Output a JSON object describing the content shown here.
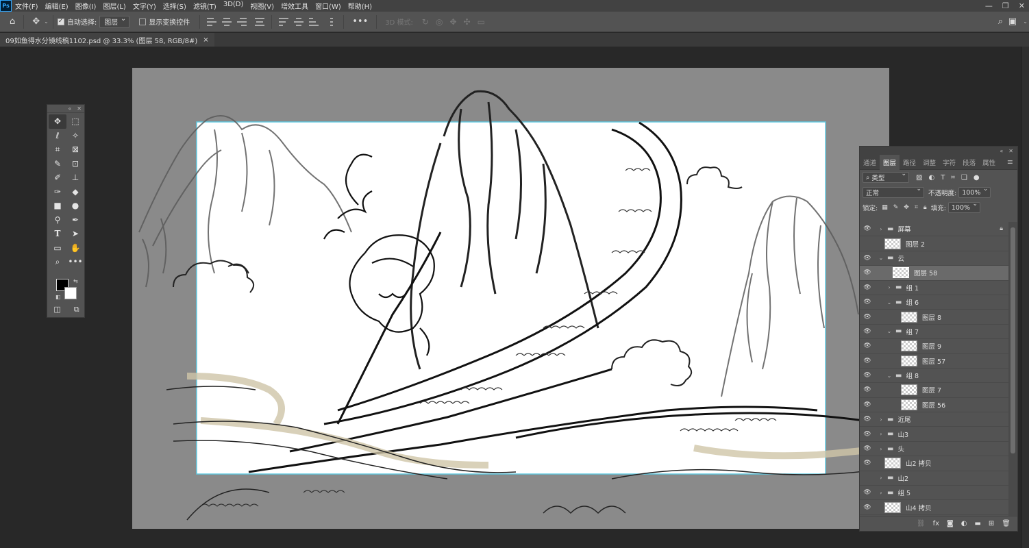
{
  "app": {
    "logo": "Ps"
  },
  "menu": [
    "文件(F)",
    "编辑(E)",
    "图像(I)",
    "图层(L)",
    "文字(Y)",
    "选择(S)",
    "滤镜(T)",
    "3D(D)",
    "视图(V)",
    "增效工具",
    "窗口(W)",
    "帮助(H)"
  ],
  "window_controls": {
    "minimize": "—",
    "restore": "❐",
    "close": "✕"
  },
  "options": {
    "auto_select_label": "自动选择:",
    "auto_select_value": "图层",
    "transform_label": "显示变换控件",
    "more": "•••",
    "mode3d_label": "3D 模式:"
  },
  "document": {
    "tab_title": "09如鱼得水分镜线稿1102.psd @ 33.3% (图层 58, RGB/8#)",
    "tab_close": "×"
  },
  "tools_panel": {
    "collapse": "«",
    "close": "✕"
  },
  "layers_panel": {
    "tabs": [
      "通道",
      "图层",
      "路径",
      "调整",
      "字符",
      "段落",
      "属性"
    ],
    "active_tab": "图层",
    "filter_type": "类型",
    "blend_mode": "正常",
    "opacity_label": "不透明度:",
    "opacity_value": "100%",
    "lock_label": "锁定:",
    "fill_label": "填充:",
    "fill_value": "100%",
    "layers": [
      {
        "name": "屏幕",
        "kind": "group",
        "visible": true,
        "locked": true,
        "indent": 0,
        "expanded": false
      },
      {
        "name": "图层 2",
        "kind": "layer",
        "visible": false,
        "indent": 0
      },
      {
        "name": "云",
        "kind": "group",
        "visible": true,
        "indent": 0,
        "expanded": true
      },
      {
        "name": "图层 58",
        "kind": "layer",
        "visible": true,
        "indent": 1,
        "selected": true
      },
      {
        "name": "组 1",
        "kind": "group",
        "visible": true,
        "indent": 1,
        "expanded": false
      },
      {
        "name": "组 6",
        "kind": "group",
        "visible": true,
        "indent": 1,
        "expanded": true
      },
      {
        "name": "图层 8",
        "kind": "layer",
        "visible": true,
        "indent": 2
      },
      {
        "name": "组 7",
        "kind": "group",
        "visible": true,
        "indent": 1,
        "expanded": true
      },
      {
        "name": "图层 9",
        "kind": "layer",
        "visible": true,
        "indent": 2
      },
      {
        "name": "图层 57",
        "kind": "layer",
        "visible": true,
        "indent": 2
      },
      {
        "name": "组 8",
        "kind": "group",
        "visible": true,
        "indent": 1,
        "expanded": true
      },
      {
        "name": "图层 7",
        "kind": "layer",
        "visible": true,
        "indent": 2
      },
      {
        "name": "图层 56",
        "kind": "layer",
        "visible": true,
        "indent": 2
      },
      {
        "name": "近尾",
        "kind": "group",
        "visible": true,
        "indent": 0,
        "expanded": false
      },
      {
        "name": "山3",
        "kind": "group",
        "visible": true,
        "indent": 0,
        "expanded": false
      },
      {
        "name": "头",
        "kind": "group",
        "visible": true,
        "indent": 0,
        "expanded": false
      },
      {
        "name": "山2 拷贝",
        "kind": "layer",
        "visible": true,
        "indent": 0
      },
      {
        "name": "山2",
        "kind": "group",
        "visible": false,
        "indent": 0,
        "expanded": false
      },
      {
        "name": "组 5",
        "kind": "group",
        "visible": true,
        "indent": 0,
        "expanded": false
      },
      {
        "name": "山4 拷贝",
        "kind": "layer",
        "visible": true,
        "indent": 0
      }
    ],
    "bottom_icons": [
      "link-icon",
      "fx-icon",
      "mask-icon",
      "adjustment-icon",
      "new-group-icon",
      "new-layer-icon",
      "trash-icon"
    ]
  },
  "colors": {
    "foreground": "#000000",
    "background": "#ffffff",
    "selection_frame": "#5fc8e0"
  }
}
